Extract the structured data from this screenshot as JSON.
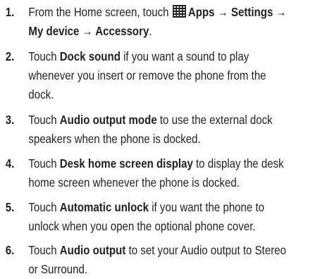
{
  "steps": [
    {
      "number": "1.",
      "line1_pre": "From the Home screen, touch ",
      "line1_bold": "Apps → Settings →",
      "line2_bold": "My device → Accessory",
      "line2_post": "."
    },
    {
      "number": "2.",
      "pre": "Touch ",
      "bold": "Dock sound",
      "line1_post": " if you want a sound to play",
      "line2": "whenever you insert or remove the phone from the",
      "line3": "dock."
    },
    {
      "number": "3.",
      "pre": "Touch ",
      "bold": "Audio output mode",
      "line1_post": " to use the external dock",
      "line2": "speakers when the phone is docked."
    },
    {
      "number": "4.",
      "pre": "Touch ",
      "bold": "Desk home screen display",
      "line1_post": " to display the desk",
      "line2": "home screen whenever the phone is docked."
    },
    {
      "number": "5.",
      "pre": "Touch ",
      "bold": "Automatic unlock",
      "line1_post": " if you want the phone to",
      "line2": "unlock when you open the optional phone cover."
    },
    {
      "number": "6.",
      "pre": "Touch ",
      "bold": "Audio output",
      "line1_post": " to set your Audio output to Stereo",
      "line2": "or Surround."
    }
  ],
  "icons": {
    "apps": "apps-grid-icon"
  }
}
